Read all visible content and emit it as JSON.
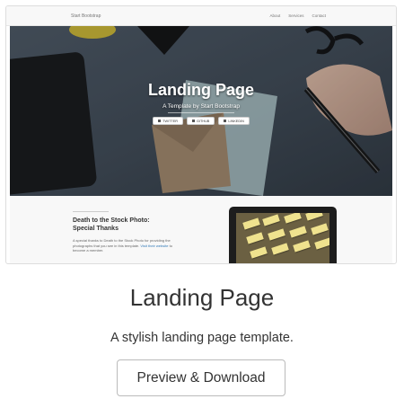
{
  "thumbnail": {
    "nav": {
      "brand": "Start Bootstrap",
      "links": [
        "About",
        "Services",
        "Contact"
      ]
    },
    "hero": {
      "title": "Landing Page",
      "subtitle": "A Template by Start Bootstrap",
      "buttons": [
        {
          "label": "TWITTER",
          "icon": "twitter-icon"
        },
        {
          "label": "GITHUB",
          "icon": "github-icon"
        },
        {
          "label": "LINKEDIN",
          "icon": "linkedin-icon"
        }
      ]
    },
    "section": {
      "title": "Death to the Stock Photo: Special Thanks",
      "text": "A special thanks to Death to the Stock Photo for providing the photographs that you see in this template.",
      "link": "Visit their website",
      "text_end": "to become a member."
    }
  },
  "caption": {
    "title": "Landing Page",
    "description": "A stylish landing page template.",
    "button_label": "Preview & Download"
  }
}
